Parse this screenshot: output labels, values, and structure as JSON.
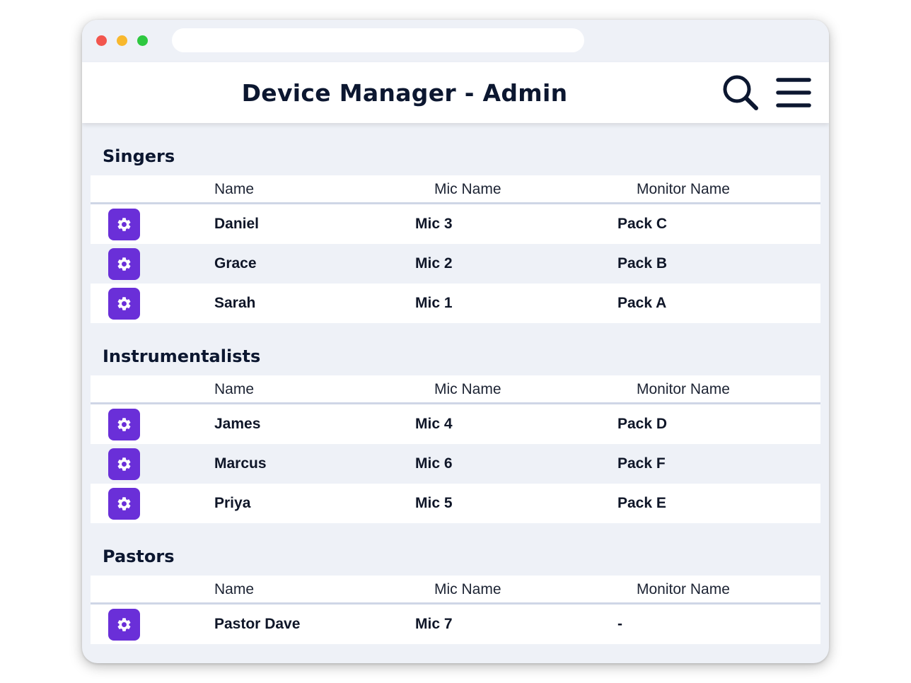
{
  "app": {
    "title": "Device Manager - Admin"
  },
  "icons": {
    "search": "search-icon",
    "menu": "hamburger-menu-icon",
    "settings": "gear-icon"
  },
  "colors": {
    "accent": "#6a2fd8",
    "text": "#0c1730",
    "background": "#eef1f7"
  },
  "columns": {
    "name": "Name",
    "mic": "Mic Name",
    "monitor": "Monitor Name"
  },
  "sections": [
    {
      "title": "Singers",
      "rows": [
        {
          "name": "Daniel",
          "mic": "Mic 3",
          "monitor": "Pack C"
        },
        {
          "name": "Grace",
          "mic": "Mic 2",
          "monitor": "Pack B"
        },
        {
          "name": "Sarah",
          "mic": "Mic 1",
          "monitor": "Pack A"
        }
      ]
    },
    {
      "title": "Instrumentalists",
      "rows": [
        {
          "name": "James",
          "mic": "Mic 4",
          "monitor": "Pack D"
        },
        {
          "name": "Marcus",
          "mic": "Mic 6",
          "monitor": "Pack F"
        },
        {
          "name": "Priya",
          "mic": "Mic 5",
          "monitor": "Pack E"
        }
      ]
    },
    {
      "title": "Pastors",
      "rows": [
        {
          "name": "Pastor Dave",
          "mic": "Mic 7",
          "monitor": "-"
        }
      ]
    }
  ]
}
